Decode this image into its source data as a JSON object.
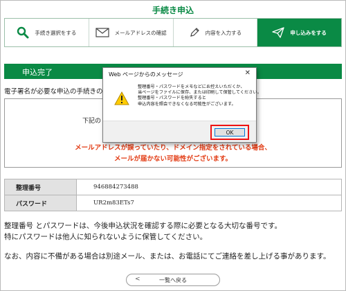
{
  "page": {
    "title": "手続き申込"
  },
  "steps": [
    {
      "label": "手続き選択をする",
      "icon": "search-icon",
      "active": false
    },
    {
      "label": "メールアドレスの確認",
      "icon": "envelope-icon",
      "active": false
    },
    {
      "label": "内容を入力する",
      "icon": "pencil-icon",
      "active": false
    },
    {
      "label": "申し込みをする",
      "icon": "paper-plane-icon",
      "active": true
    }
  ],
  "section": {
    "title": "申込完了"
  },
  "intro": "電子署名が必要な申込の手続きの申込",
  "notice": {
    "partial": "下記の",
    "warning_line1": "メールアドレスが誤っていたり、ドメイン指定をされている場合、",
    "warning_line2": "メールが届かない可能性がございます。"
  },
  "info_table": [
    {
      "label": "整理番号",
      "value": "946884273488"
    },
    {
      "label": "パスワード",
      "value": "UR2m83ETs7"
    }
  ],
  "body_text": [
    "整理番号 とパスワードは、今後申込状況を確認する際に必要となる大切な番号です。",
    "特にパスワードは他人に知られないように保管してください。",
    "なお、内容に不備がある場合は別途メール、または、お電話にてご連絡を差し上げる事があります。"
  ],
  "back_button": {
    "label": "一覧へ戻る",
    "chevron": "<"
  },
  "dialog": {
    "title": "Web ページからのメッセージ",
    "close": "✕",
    "icon": "warning-icon",
    "lines": [
      "整理番号・パスワードをメモなどにお控えいただくか、",
      "当ページをファイルに保存、または印刷して保管してください。",
      "整理番号・パスワードを紛失すると",
      "申込内容を照会できなくなる可能性がございます。"
    ],
    "ok_label": "OK"
  },
  "colors": {
    "brand_green": "#0a8a45",
    "warning_red": "#e23a12",
    "highlight_red": "#e11111",
    "focus_blue": "#0078d7"
  }
}
